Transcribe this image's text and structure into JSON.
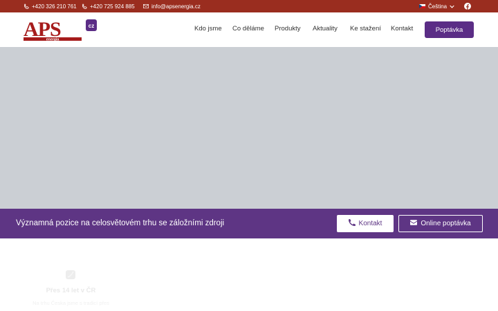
{
  "topbar": {
    "phone1": "+420 326 210 761",
    "phone2": "+420 725 924 885",
    "email": "info@apsenergia.cz",
    "language": "Čeština",
    "icons": {
      "phone": "phone-icon",
      "email": "envelope-icon",
      "facebook": "facebook-icon",
      "chevron": "chevron-down-icon"
    }
  },
  "logo": {
    "main": "APS",
    "sub": "energia",
    "badge": "cz"
  },
  "nav": {
    "items": [
      {
        "label": "Kdo jsme"
      },
      {
        "label": "Co děláme"
      },
      {
        "label": "Produkty"
      },
      {
        "label": "Aktuality"
      },
      {
        "label": "Ke stažení"
      },
      {
        "label": "Kontakt"
      }
    ],
    "cta": "Poptávka"
  },
  "strip": {
    "text": "Významná pozice na celosvětovém trhu se záložními zdroji",
    "contact_button": "Kontakt",
    "inquiry_button": "Online poptávka"
  },
  "feature": {
    "title": "Přes 14 let v ČR",
    "subtitle": "Na trhu Česka jsme s tradicí přes"
  },
  "colors": {
    "topbar": "#9a2d1f",
    "brand_red": "#a61c1c",
    "brand_purple": "#5b2d86",
    "hero_placeholder": "#cbcfd4"
  }
}
